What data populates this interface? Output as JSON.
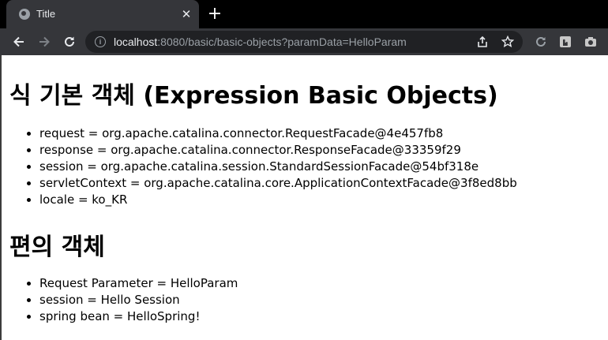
{
  "browser": {
    "tab_title": "Title",
    "close_glyph": "✕",
    "newtab_glyph": "+",
    "url_host": "localhost",
    "url_rest": ":8080/basic/basic-objects?paramData=HelloParam",
    "colors": {
      "chrome_bg": "#35363a",
      "tabstrip_bg": "#000000",
      "omnibox_bg": "#202124"
    }
  },
  "page": {
    "heading1": "식 기본 객체 (Expression Basic Objects)",
    "basic_objects": [
      "request = org.apache.catalina.connector.RequestFacade@4e457fb8",
      "response = org.apache.catalina.connector.ResponseFacade@33359f29",
      "session = org.apache.catalina.session.StandardSessionFacade@54bf318e",
      "servletContext = org.apache.catalina.core.ApplicationContextFacade@3f8ed8bb",
      "locale = ko_KR"
    ],
    "heading2": "편의 객체",
    "convenience_objects": [
      "Request Parameter = HelloParam",
      "session = Hello Session",
      "spring bean = HelloSpring!"
    ]
  }
}
